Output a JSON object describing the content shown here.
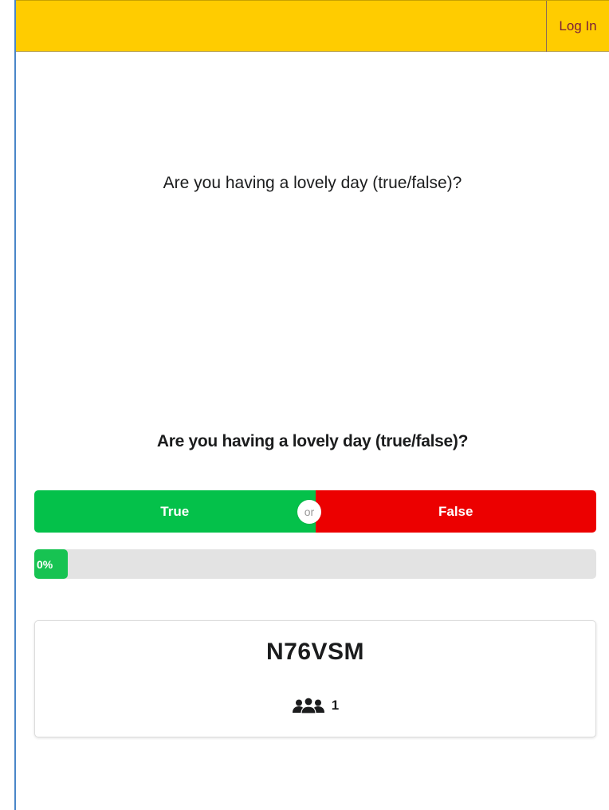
{
  "header": {
    "login_label": "Log In",
    "background_color": "#ffcc00"
  },
  "poll": {
    "question_preview": "Are you having a lovely day (true/false)?",
    "question": "Are you having a lovely day (true/false)?",
    "options": {
      "true_label": "True",
      "false_label": "False",
      "separator": "or"
    },
    "result": {
      "percent_label": "0%",
      "fraction": 0
    },
    "colors": {
      "true": "#04c14a",
      "false": "#ec0000",
      "progress": "#17c352"
    }
  },
  "session": {
    "code": "N76VSM",
    "participants_icon": "users-icon",
    "participant_count": "1"
  }
}
